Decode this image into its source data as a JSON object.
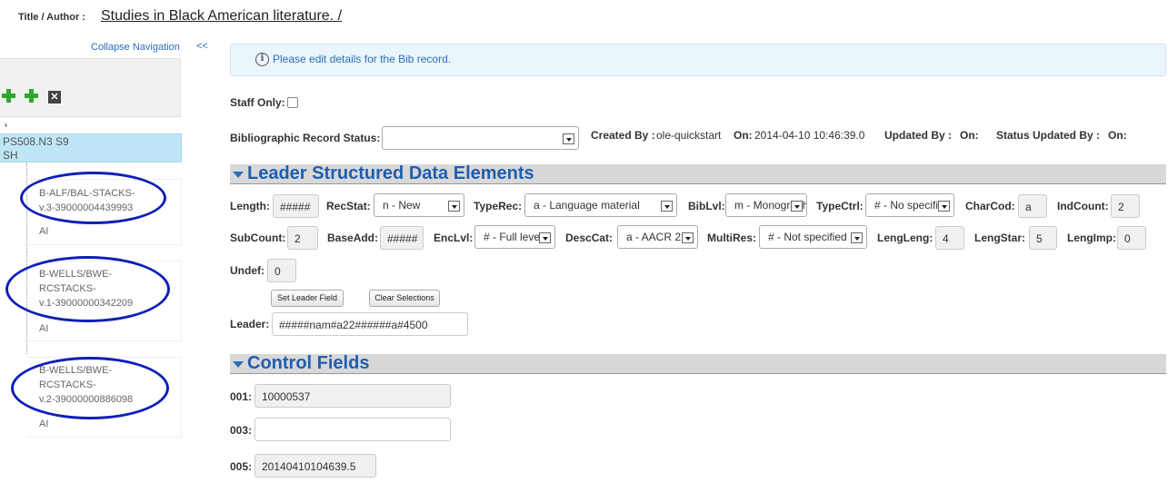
{
  "header": {
    "title_label": "Title / Author :",
    "title_value": "Studies in Black American literature. /"
  },
  "nav": {
    "collapse_label": "Collapse Navigation",
    "collapse_chevron": "<<",
    "tree_glyph": "⸤",
    "selected": {
      "line1": "PS508.N3 S9",
      "line2": "SH"
    },
    "items": [
      {
        "line1": "B-ALF/BAL-STACKS-",
        "line2": "v.3-39000004439993",
        "location": "AI"
      },
      {
        "line1": "B-WELLS/BWE-",
        "line2": "RCSTACKS-",
        "line3": "v.1-39000000342209",
        "location": "AI"
      },
      {
        "line1": "B-WELLS/BWE-",
        "line2": "RCSTACKS-",
        "line3": "v.2-39000000886098",
        "location": "AI"
      }
    ],
    "icons": [
      "plus-icon",
      "plus-icon",
      "close-icon"
    ]
  },
  "info": {
    "icon": "info-icon",
    "message": "Please edit details for the Bib record."
  },
  "staff_only": {
    "label": "Staff Only:",
    "checked": false
  },
  "status": {
    "label": "Bibliographic Record Status:",
    "value": "",
    "created_by_label": "Created By :",
    "created_by_value": "ole-quickstart",
    "on_label": "On:",
    "on_value": "2014-04-10 10:46:39.0",
    "updated_by_label": "Updated By :",
    "updated_on_label": "On:",
    "status_updated_by_label": "Status Updated By :",
    "status_updated_on_label": "On:"
  },
  "leader_section": {
    "title": "Leader Structured Data Elements",
    "row1": {
      "length_label": "Length:",
      "length_value": "#####",
      "recstat_label": "RecStat:",
      "recstat_value": "n - New",
      "typerec_label": "TypeRec:",
      "typerec_value": "a - Language material",
      "biblvl_label": "BibLvl:",
      "biblvl_value": "m - Monograph",
      "typectrl_label": "TypeCtrl:",
      "typectrl_value": "# - No specified type",
      "charcod_label": "CharCod:",
      "charcod_value": "a",
      "indcount_label": "IndCount:",
      "indcount_value": "2"
    },
    "row2": {
      "subcount_label": "SubCount:",
      "subcount_value": "2",
      "baseadd_label": "BaseAdd:",
      "baseadd_value": "#####",
      "enclvl_label": "EncLvl:",
      "enclvl_value": "# - Full level",
      "desccat_label": "DescCat:",
      "desccat_value": "a - AACR 2",
      "multires_label": "MultiRes:",
      "multires_value": "# - Not specified",
      "lengleng_label": "LengLeng:",
      "lengleng_value": "4",
      "lengstar_label": "LengStar:",
      "lengstar_value": "5",
      "lengimp_label": "LengImp:",
      "lengimp_value": "0"
    },
    "undef_label": "Undef:",
    "undef_value": "0",
    "set_leader_button": "Set Leader Field",
    "clear_button": "Clear Selections",
    "leader_label": "Leader:",
    "leader_value": "#####nam#a22######a#4500"
  },
  "control_section": {
    "title": "Control Fields",
    "f001_label": "001:",
    "f001_value": "10000537",
    "f003_label": "003:",
    "f003_value": "",
    "f005_label": "005:",
    "f005_value": "20140410104639.5"
  },
  "colors": {
    "link": "#2a6ebb",
    "section_title": "#1f5fb0",
    "selected_node": "#bfe6f6",
    "circle": "#0d1fb8",
    "plus": "#2fa82f"
  }
}
